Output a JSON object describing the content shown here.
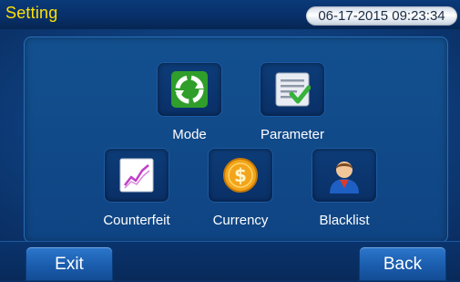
{
  "header": {
    "title": "Setting",
    "datetime": "06-17-2015 09:23:34"
  },
  "menu": {
    "mode": {
      "label": "Mode",
      "icon": "mode-icon"
    },
    "parameter": {
      "label": "Parameter",
      "icon": "parameter-icon"
    },
    "counterfeit": {
      "label": "Counterfeit",
      "icon": "counterfeit-icon"
    },
    "currency": {
      "label": "Currency",
      "icon": "currency-icon"
    },
    "blacklist": {
      "label": "Blacklist",
      "icon": "blacklist-icon"
    }
  },
  "footer": {
    "exit_label": "Exit",
    "back_label": "Back"
  },
  "colors": {
    "title": "#ffe100",
    "accent": "#1c5fb0",
    "background": "#0b2f63"
  }
}
